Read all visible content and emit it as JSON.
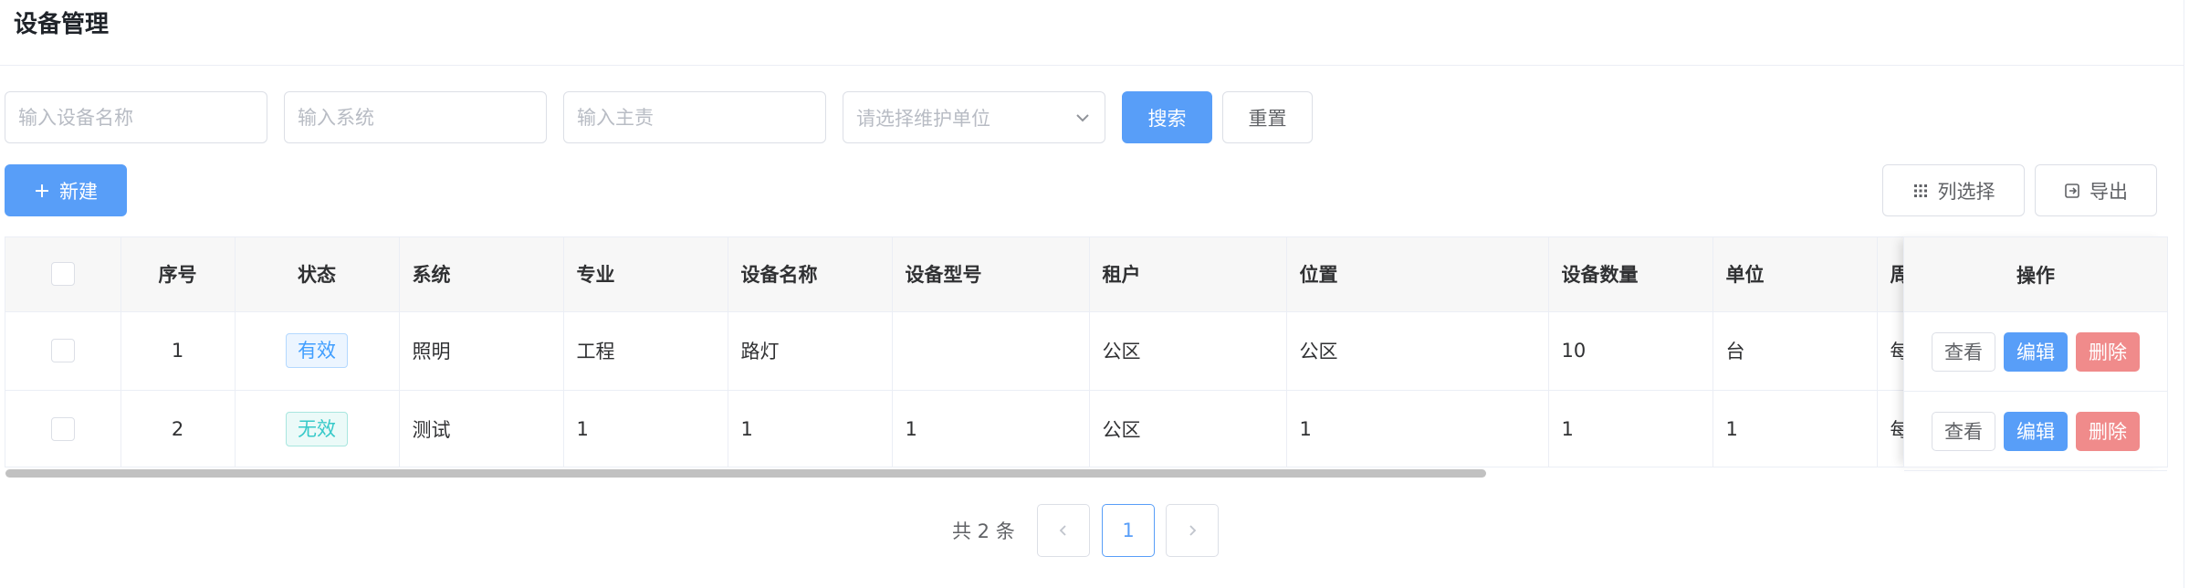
{
  "page": {
    "title": "设备管理"
  },
  "filters": {
    "device_name_placeholder": "输入设备名称",
    "system_placeholder": "输入系统",
    "owner_placeholder": "输入主责",
    "maintenance_unit_placeholder": "请选择维护单位",
    "search_label": "搜索",
    "reset_label": "重置"
  },
  "toolbar": {
    "new_label": "新建",
    "columns_label": "列选择",
    "export_label": "导出"
  },
  "table": {
    "columns": [
      "序号",
      "状态",
      "系统",
      "专业",
      "设备名称",
      "设备型号",
      "租户",
      "位置",
      "设备数量",
      "单位",
      "周"
    ],
    "action_column": "操作",
    "rows": [
      {
        "index": "1",
        "status": "有效",
        "system": "照明",
        "major": "工程",
        "device_name": "路灯",
        "model": "",
        "tenant": "公区",
        "location": "公区",
        "quantity": "10",
        "unit": "台",
        "cycle": "每"
      },
      {
        "index": "2",
        "status": "无效",
        "system": "测试",
        "major": "1",
        "device_name": "1",
        "model": "1",
        "tenant": "公区",
        "location": "1",
        "quantity": "1",
        "unit": "1",
        "cycle": "每"
      }
    ],
    "actions": {
      "view": "查看",
      "edit": "编辑",
      "delete": "删除"
    }
  },
  "pagination": {
    "total_text": "共 2 条",
    "current_page": "1"
  },
  "colors": {
    "primary": "#589ef8",
    "danger": "#f08b8b",
    "status_valid": "#409eff",
    "status_invalid": "#36c9c9"
  },
  "icons": [
    "plus-icon",
    "grid-icon",
    "export-icon",
    "chevron-down-icon",
    "chevron-left-icon",
    "chevron-right-icon"
  ]
}
